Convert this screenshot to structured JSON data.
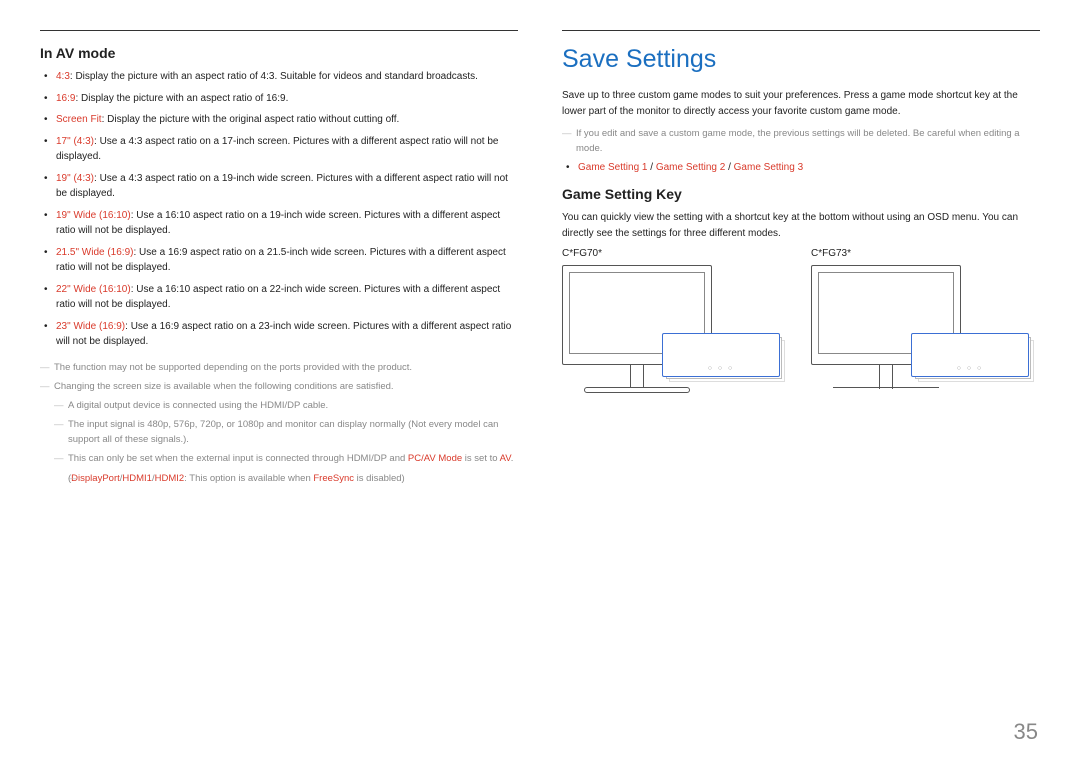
{
  "left": {
    "heading": "In AV mode",
    "items": [
      {
        "hl": "4:3",
        "text": ": Display the picture with an aspect ratio of 4:3. Suitable for videos and standard broadcasts."
      },
      {
        "hl": "16:9",
        "text": ": Display the picture with an aspect ratio of 16:9."
      },
      {
        "hl": "Screen Fit",
        "text": ": Display the picture with the original aspect ratio without cutting off."
      },
      {
        "hl": "17\" (4:3)",
        "text": ": Use a 4:3 aspect ratio on a 17-inch screen. Pictures with a different aspect ratio will not be displayed."
      },
      {
        "hl": "19\" (4:3)",
        "text": ": Use a 4:3 aspect ratio on a 19-inch wide screen. Pictures with a different aspect ratio will not be displayed."
      },
      {
        "hl": "19\" Wide (16:10)",
        "text": ": Use a 16:10 aspect ratio on a 19-inch wide screen. Pictures with a different aspect ratio will not be displayed."
      },
      {
        "hl": "21.5\" Wide (16:9)",
        "text": ": Use a 16:9 aspect ratio on a 21.5-inch wide screen. Pictures with a different aspect ratio will not be displayed."
      },
      {
        "hl": "22\" Wide (16:10)",
        "text": ": Use a 16:10 aspect ratio on a 22-inch wide screen. Pictures with a different aspect ratio will not be displayed."
      },
      {
        "hl": "23\" Wide (16:9)",
        "text": ": Use a 16:9 aspect ratio on a 23-inch wide screen. Pictures with a different aspect ratio will not be displayed."
      }
    ],
    "notes": {
      "n0": "The function may not be supported depending on the ports provided with the product.",
      "n1": "Changing the screen size is available when the following conditions are satisfied.",
      "n2": "A digital output device is connected using the HDMI/DP cable.",
      "n3": "The input signal is 480p, 576p, 720p, or 1080p and monitor can display normally (Not every model can support all of these signals.).",
      "n4_pre": "This can only be set when the external input is connected through HDMI/DP and ",
      "n4_hl1": "PC/AV Mode",
      "n4_mid": " is set to ",
      "n4_hl2": "AV",
      "n4_post": ".",
      "n5_pre": "(",
      "n5_hl1": "DisplayPort",
      "n5_sep1": "/",
      "n5_hl2": "HDMI1",
      "n5_sep2": "/",
      "n5_hl3": "HDMI2",
      "n5_mid": ": This option is available when ",
      "n5_hl4": "FreeSync",
      "n5_post": " is disabled)"
    }
  },
  "right": {
    "title": "Save Settings",
    "para1": "Save up to three custom game modes to suit your preferences. Press a game mode shortcut key at the lower part of the monitor to directly access your favorite custom game mode.",
    "note1": "If you edit and save a custom game mode, the previous settings will be deleted. Be careful when editing a mode.",
    "settings": {
      "s1": "Game Setting 1",
      "sep1": " / ",
      "s2": "Game Setting 2",
      "sep2": " / ",
      "s3": "Game Setting 3"
    },
    "subheading": "Game Setting Key",
    "para2": "You can quickly view the setting with a shortcut key at the bottom without using an OSD menu. You can directly see the settings for three different modes.",
    "model1": "C*FG70*",
    "model2": "C*FG73*"
  },
  "pageNumber": "35"
}
